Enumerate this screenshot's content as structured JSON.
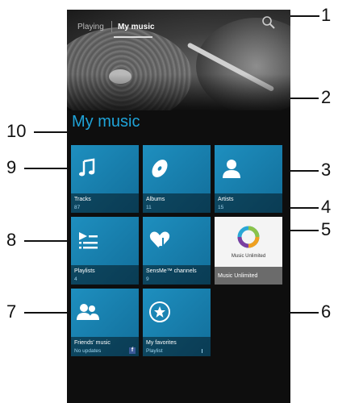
{
  "tabs": {
    "playing": "Playing",
    "my_music": "My music"
  },
  "page_title": "My music",
  "tiles": [
    {
      "label": "Tracks",
      "sub": "87",
      "icon": "note-icon"
    },
    {
      "label": "Albums",
      "sub": "11",
      "icon": "disc-icon"
    },
    {
      "label": "Artists",
      "sub": "15",
      "icon": "person-icon"
    },
    {
      "label": "Playlists",
      "sub": "4",
      "icon": "playlist-icon"
    },
    {
      "label": "SensMe™ channels",
      "sub": "9",
      "icon": "heart-note-icon"
    },
    {
      "label": "Music Unlimited",
      "sub": "",
      "icon": "music-unlimited-logo",
      "logo_text": "Music Unlimited"
    },
    {
      "label": "Friends' music",
      "sub": "No updates",
      "icon": "friends-icon"
    },
    {
      "label": "My favorites",
      "sub": "Playlist",
      "icon": "star-icon"
    }
  ],
  "callouts": [
    "1",
    "2",
    "3",
    "4",
    "5",
    "6",
    "7",
    "8",
    "9",
    "10"
  ],
  "colors": {
    "accent": "#1fa3d8",
    "tile": "#1a85b5"
  }
}
